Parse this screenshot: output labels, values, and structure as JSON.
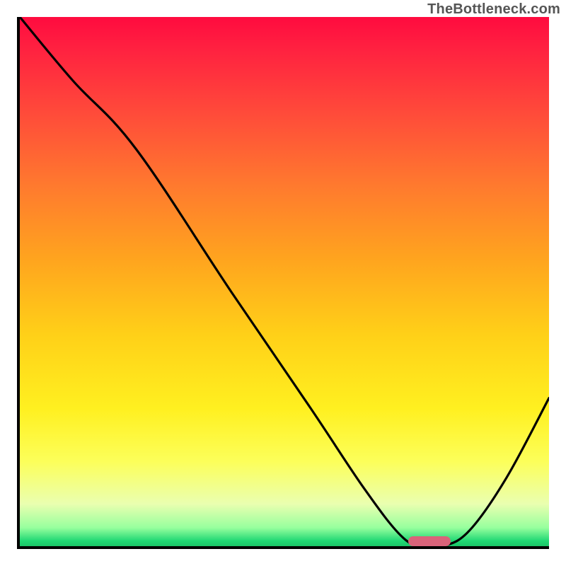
{
  "watermark": "TheBottleneck.com",
  "colors": {
    "gradient_top": "#ff0b3f",
    "gradient_bottom": "#1bc567",
    "curve": "#000000",
    "marker": "#d9637a",
    "axis": "#000000"
  },
  "chart_data": {
    "type": "line",
    "title": "",
    "xlabel": "",
    "ylabel": "",
    "xlim": [
      0,
      100
    ],
    "ylim": [
      0,
      100
    ],
    "grid": false,
    "legend": false,
    "series": [
      {
        "name": "bottleneck-curve",
        "x": [
          0,
          10,
          22,
          40,
          55,
          65,
          72,
          76,
          80,
          85,
          92,
          100
        ],
        "values": [
          100,
          88,
          75,
          48,
          26,
          11,
          2,
          0,
          0,
          3,
          13,
          28
        ]
      }
    ],
    "marker": {
      "name": "optimal-range",
      "x_start": 73,
      "x_end": 81,
      "y": 0
    }
  }
}
